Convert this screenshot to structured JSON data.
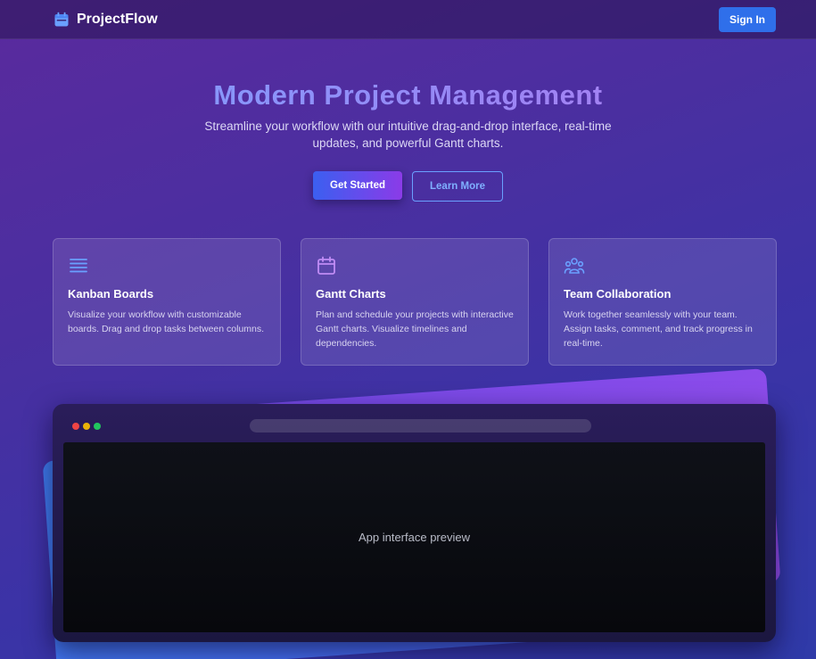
{
  "nav": {
    "brand": "ProjectFlow",
    "brand_icon": "calendar-icon",
    "signin_label": "Sign In"
  },
  "hero": {
    "title": "Modern Project Management",
    "subtitle": "Streamline your workflow with our intuitive drag-and-drop interface, real-time updates, and powerful Gantt charts.",
    "primary_label": "Get Started",
    "secondary_label": "Learn More"
  },
  "features": [
    {
      "icon": "list-icon",
      "title": "Kanban Boards",
      "text": "Visualize your workflow with customizable boards. Drag and drop tasks between columns."
    },
    {
      "icon": "calendar-icon",
      "title": "Gantt Charts",
      "text": "Plan and schedule your projects with interactive Gantt charts. Visualize timelines and dependencies."
    },
    {
      "icon": "team-icon",
      "title": "Team Collaboration",
      "text": "Work together seamlessly with your team. Assign tasks, comment, and track progress in real-time."
    }
  ],
  "preview": {
    "label": "App interface preview",
    "dot_colors": [
      "#ef4444",
      "#eab308",
      "#22c55e"
    ]
  },
  "colors": {
    "accent_blue": "#2f6fea",
    "accent_purple": "#8b3be8",
    "icon_blue": "#6aa0ff",
    "icon_purple": "#c08cf5"
  }
}
